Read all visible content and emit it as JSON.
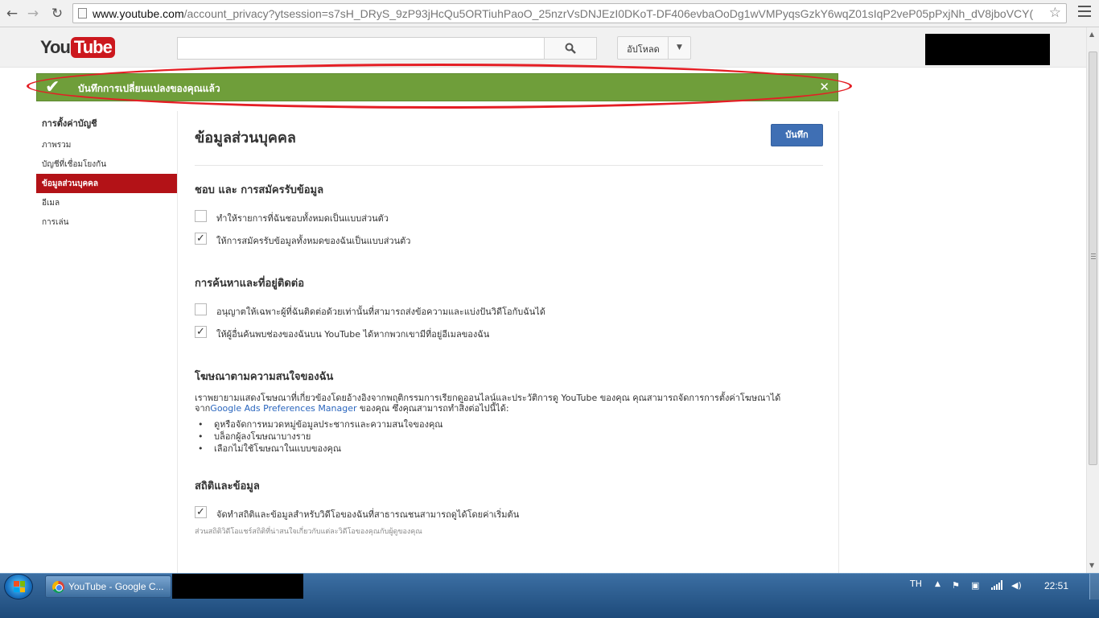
{
  "browser": {
    "url_host": "www.youtube.com",
    "url_rest": "/account_privacy?ytsession=s7sH_DRyS_9zP93jHcQu5ORTiuhPaoO_25nzrVsDNJEzI0DKoT-DF406evbaOoDg1wVMPyqsGzkY6wqZ01sIqP2veP05pPxjNh_dV8jboVCY("
  },
  "masthead": {
    "logo_you": "You",
    "logo_tube": "Tube",
    "upload_label": "อัปโหลด"
  },
  "banner": {
    "message": "บันทึกการเปลี่ยนแปลงของคุณแล้ว"
  },
  "sidebar": {
    "heading": "การตั้งค่าบัญชี",
    "items": [
      {
        "label": "ภาพรวม"
      },
      {
        "label": "บัญชีที่เชื่อมโยงกัน"
      },
      {
        "label": "ข้อมูลส่วนบุคคล"
      },
      {
        "label": "อีเมล"
      },
      {
        "label": "การเล่น"
      }
    ]
  },
  "main": {
    "title": "ข้อมูลส่วนบุคคล",
    "save_label": "บันทึก",
    "sections": [
      {
        "title": "ชอบ และ การสมัครรับข้อมูล",
        "options": [
          {
            "label": "ทำให้รายการที่ฉันชอบทั้งหมดเป็นแบบส่วนตัว",
            "checked": false
          },
          {
            "label": "ให้การสมัครรับข้อมูลทั้งหมดของฉันเป็นแบบส่วนตัว",
            "checked": true
          }
        ]
      },
      {
        "title": "การค้นหาและที่อยู่ติดต่อ",
        "options": [
          {
            "label": "อนุญาตให้เฉพาะผู้ที่ฉันติดต่อด้วยเท่านั้นที่สามารถส่งข้อความและแบ่งปันวิดีโอกับฉันได้",
            "checked": false
          },
          {
            "label": "ให้ผู้อื่นค้นพบช่องของฉันบน YouTube ได้หากพวกเขามีที่อยู่อีเมลของฉัน",
            "checked": true
          }
        ]
      },
      {
        "title": "โฆษณาตามความสนใจของฉัน",
        "paragraph_before": "เราพยายามแสดงโฆษณาที่เกี่ยวข้องโดยอ้างอิงจากพฤติกรรมการเรียกดูออนไลน์และประวัติการดู YouTube ของคุณ คุณสามารถจัดการการตั้งค่าโฆษณาได้จาก",
        "link": "Google Ads Preferences Manager",
        "paragraph_after": " ของคุณ ซึ่งคุณสามารถทำสิ่งต่อไปนี้ได้:",
        "bullets": [
          "ดูหรือจัดการหมวดหมู่ข้อมูลประชากรและความสนใจของคุณ",
          "บล็อกผู้ลงโฆษณาบางราย",
          "เลือกไม่ใช้โฆษณาในแบบของคุณ"
        ]
      },
      {
        "title": "สถิติและข้อมูล",
        "options": [
          {
            "label": "จัดทำสถิติและข้อมูลสำหรับวิดีโอของฉันที่สาธารณชนสามารถดูได้โดยค่าเริ่มต้น",
            "checked": true
          }
        ],
        "hint": "ส่วนสถิติวิดีโอแชร์สถิติที่น่าสนใจเกี่ยวกับแต่ละวิดีโอของคุณกับผู้ดูของคุณ"
      }
    ]
  },
  "taskbar": {
    "task_label": "YouTube - Google C...",
    "lang": "TH",
    "clock": "22:51"
  }
}
